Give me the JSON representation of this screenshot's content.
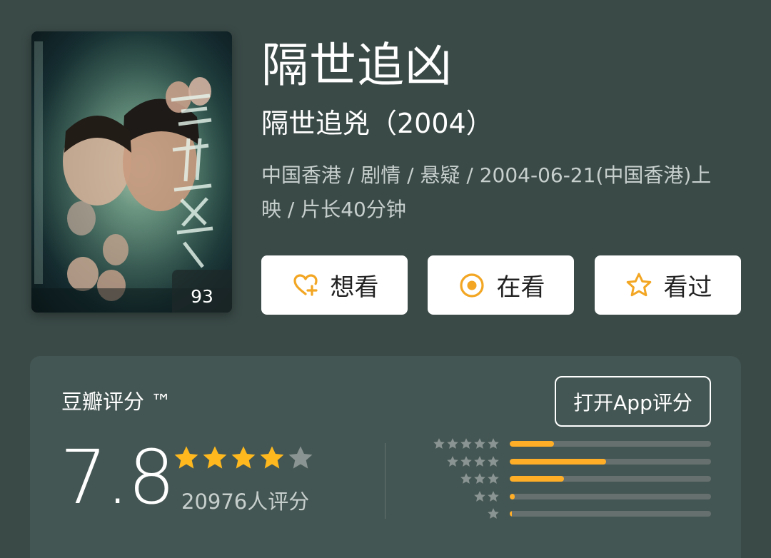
{
  "poster": {
    "badge": "93",
    "alt": "隔世追兇"
  },
  "title": "隔世追凶",
  "subtitle": "隔世追兇（2004）",
  "meta": "中国香港 / 剧情 / 悬疑 / 2004-06-21(中国香港)上映 / 片长40分钟",
  "actions": {
    "want": "想看",
    "watching": "在看",
    "watched": "看过"
  },
  "rating": {
    "label": "豆瓣评分 ™",
    "open_app": "打开App评分",
    "score": "7.8",
    "stars_filled": 4,
    "stars_total": 5,
    "count_text": "20976人评分",
    "distribution": [
      {
        "stars": 5,
        "fraction": 0.22
      },
      {
        "stars": 4,
        "fraction": 0.48
      },
      {
        "stars": 3,
        "fraction": 0.27
      },
      {
        "stars": 2,
        "fraction": 0.025
      },
      {
        "stars": 1,
        "fraction": 0.008
      }
    ]
  },
  "colors": {
    "background": "#3a4a47",
    "panel": "#445653",
    "accent": "#ffae28",
    "star_filled": "#ffb91e",
    "star_empty": "#8a9593",
    "track": "#66716f"
  }
}
